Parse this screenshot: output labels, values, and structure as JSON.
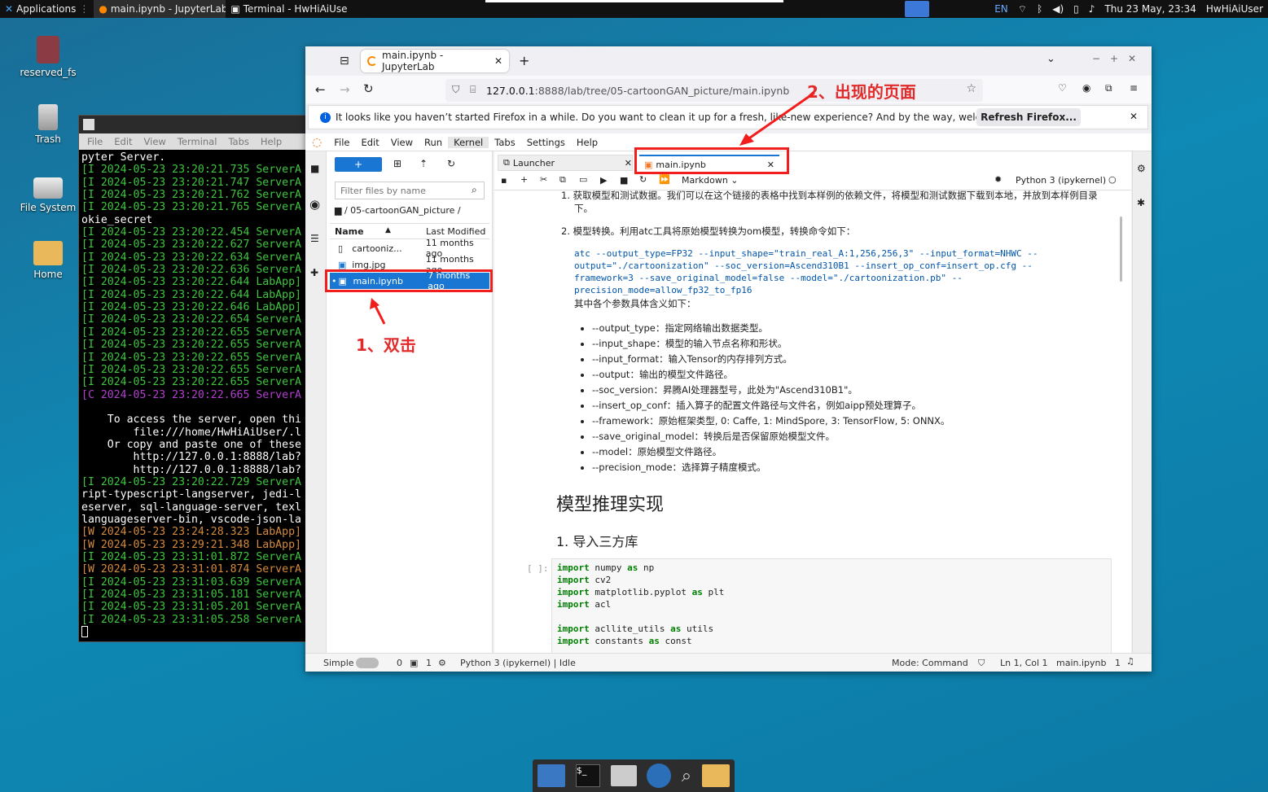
{
  "panel": {
    "apps_label": "Applications",
    "tasks": [
      "main.ipynb - JupyterLab ...",
      "Terminal - HwHiAiUser..."
    ],
    "lang": "EN",
    "datetime": "Thu 23 May, 23:34",
    "user": "HwHiAiUser"
  },
  "desktop": {
    "icons": [
      "reserved_fs",
      "Trash",
      "File System",
      "Home"
    ]
  },
  "terminal": {
    "menu": [
      "File",
      "Edit",
      "View",
      "Terminal",
      "Tabs",
      "Help"
    ],
    "lines": [
      {
        "c": "w",
        "t": "pyter Server."
      },
      {
        "c": "g",
        "t": "[I 2024-05-23 23:20:21.735 ServerA"
      },
      {
        "c": "g",
        "t": "[I 2024-05-23 23:20:21.747 ServerA"
      },
      {
        "c": "g",
        "t": "[I 2024-05-23 23:20:21.762 ServerA"
      },
      {
        "c": "g",
        "t": "[I 2024-05-23 23:20:21.765 ServerA"
      },
      {
        "c": "w",
        "t": "okie_secret"
      },
      {
        "c": "g",
        "t": "[I 2024-05-23 23:20:22.454 ServerA"
      },
      {
        "c": "g",
        "t": "[I 2024-05-23 23:20:22.627 ServerA"
      },
      {
        "c": "g",
        "t": "[I 2024-05-23 23:20:22.634 ServerA"
      },
      {
        "c": "g",
        "t": "[I 2024-05-23 23:20:22.636 ServerA"
      },
      {
        "c": "g",
        "t": "[I 2024-05-23 23:20:22.644 LabApp]"
      },
      {
        "c": "g",
        "t": "[I 2024-05-23 23:20:22.644 LabApp]"
      },
      {
        "c": "g",
        "t": "[I 2024-05-23 23:20:22.646 LabApp]"
      },
      {
        "c": "g",
        "t": "[I 2024-05-23 23:20:22.654 ServerA"
      },
      {
        "c": "g",
        "t": "[I 2024-05-23 23:20:22.655 ServerA"
      },
      {
        "c": "g",
        "t": "[I 2024-05-23 23:20:22.655 ServerA"
      },
      {
        "c": "g",
        "t": "[I 2024-05-23 23:20:22.655 ServerA"
      },
      {
        "c": "g",
        "t": "[I 2024-05-23 23:20:22.655 ServerA"
      },
      {
        "c": "g",
        "t": "[I 2024-05-23 23:20:22.655 ServerA"
      },
      {
        "c": "m",
        "t": "[C 2024-05-23 23:20:22.665 ServerA"
      },
      {
        "c": "w",
        "t": ""
      },
      {
        "c": "w",
        "t": "    To access the server, open thi"
      },
      {
        "c": "w",
        "t": "        file:///home/HwHiAiUser/.l"
      },
      {
        "c": "w",
        "t": "    Or copy and paste one of these"
      },
      {
        "c": "w",
        "t": "        http://127.0.0.1:8888/lab?"
      },
      {
        "c": "w",
        "t": "        http://127.0.0.1:8888/lab?"
      },
      {
        "c": "g",
        "t": "[I 2024-05-23 23:20:22.729 ServerA"
      },
      {
        "c": "w",
        "t": "ript-typescript-langserver, jedi-l"
      },
      {
        "c": "w",
        "t": "eserver, sql-language-server, texl"
      },
      {
        "c": "w",
        "t": "languageserver-bin, vscode-json-la"
      },
      {
        "c": "o",
        "t": "[W 2024-05-23 23:24:28.323 LabApp]"
      },
      {
        "c": "o",
        "t": "[W 2024-05-23 23:29:21.348 LabApp]"
      },
      {
        "c": "g",
        "t": "[I 2024-05-23 23:31:01.872 ServerA"
      },
      {
        "c": "o",
        "t": "[W 2024-05-23 23:31:01.874 ServerA"
      },
      {
        "c": "g",
        "t": "[I 2024-05-23 23:31:03.639 ServerA"
      },
      {
        "c": "g",
        "t": "[I 2024-05-23 23:31:05.181 ServerA"
      },
      {
        "c": "g",
        "t": "[I 2024-05-23 23:31:05.201 ServerA"
      },
      {
        "c": "g",
        "t": "[I 2024-05-23 23:31:05.258 ServerA"
      }
    ]
  },
  "browser": {
    "tab_title": "main.ipynb - JupyterLab",
    "url_host": "127.0.0.1",
    "url_rest": ":8888/lab/tree/05-cartoonGAN_picture/main.ipynb",
    "notice": "It looks like you haven’t started Firefox in a while. Do you want to clean it up for a fresh, like-new experience? And by the way, welcome back!",
    "refresh_label": "Refresh Firefox..."
  },
  "jupyter": {
    "menu": [
      "File",
      "Edit",
      "View",
      "Run",
      "Kernel",
      "Tabs",
      "Settings",
      "Help"
    ],
    "filter_placeholder": "Filter files by name",
    "breadcrumb": "/ 05-cartoonGAN_picture /",
    "col_name": "Name",
    "col_modified": "Last Modified",
    "files": [
      {
        "name": "cartooniz...",
        "mod": "11 months ago"
      },
      {
        "name": "img.jpg",
        "mod": "11 months ago"
      },
      {
        "name": "main.ipynb",
        "mod": "7 months ago"
      }
    ],
    "tabs": [
      "Launcher",
      "main.ipynb"
    ],
    "cell_type": "Markdown",
    "kernel": "Python 3 (ipykernel)",
    "nb": {
      "line1": "1. 获取模型和测试数据。我们可以在这个链接的表格中找到本样例的依赖文件，将模型和测试数据下载到本地，并放到本样例目录",
      "line1b": "下。",
      "line2": "2. 模型转换。利用atc工具将原始模型转换为om模型，转换命令如下：",
      "atc1": "atc --output_type=FP32 --input_shape=\"train_real_A:1,256,256,3\" --input_format=NHWC --",
      "atc2": "output=\"./cartoonization\" --soc_version=Ascend310B1 --insert_op_conf=insert_op.cfg --",
      "atc3": "framework=3 --save_original_model=false --model=\"./cartoonization.pb\" --",
      "atc4": "precision_mode=allow_fp32_to_fp16",
      "params_intro": "其中各个参数具体含义如下：",
      "bullets": [
        "--output_type：指定网络输出数据类型。",
        "--input_shape：模型的输入节点名称和形状。",
        "--input_format：输入Tensor的内存排列方式。",
        "--output：输出的模型文件路径。",
        "--soc_version：昇腾AI处理器型号，此处为\"Ascend310B1\"。",
        "--insert_op_conf：插入算子的配置文件路径与文件名，例如aipp预处理算子。",
        "--framework：原始框架类型, 0: Caffe, 1: MindSpore, 3: TensorFlow, 5: ONNX。",
        "--save_original_model：转换后是否保留原始模型文件。",
        "--model：原始模型文件路径。",
        "--precision_mode：选择算子精度模式。"
      ],
      "h2": "模型推理实现",
      "h3": "1. 导入三方库",
      "prompt": "[ ]:",
      "code": [
        "import numpy as np",
        "import cv2",
        "import matplotlib.pyplot as plt",
        "import acl",
        "",
        "import acllite_utils as utils",
        "import constants as const"
      ]
    },
    "status": {
      "simple": "Simple",
      "zero": "0",
      "one": "1",
      "kernel_status": "Python 3 (ipykernel) | Idle",
      "mode": "Mode: Command",
      "pos": "Ln 1, Col 1",
      "file": "main.ipynb",
      "notif": "1"
    }
  },
  "annotations": {
    "a1": "1、双击",
    "a2": "2、出现的页面"
  },
  "colors": {
    "highlight": "#f21d1d",
    "accent": "#1976d2"
  }
}
